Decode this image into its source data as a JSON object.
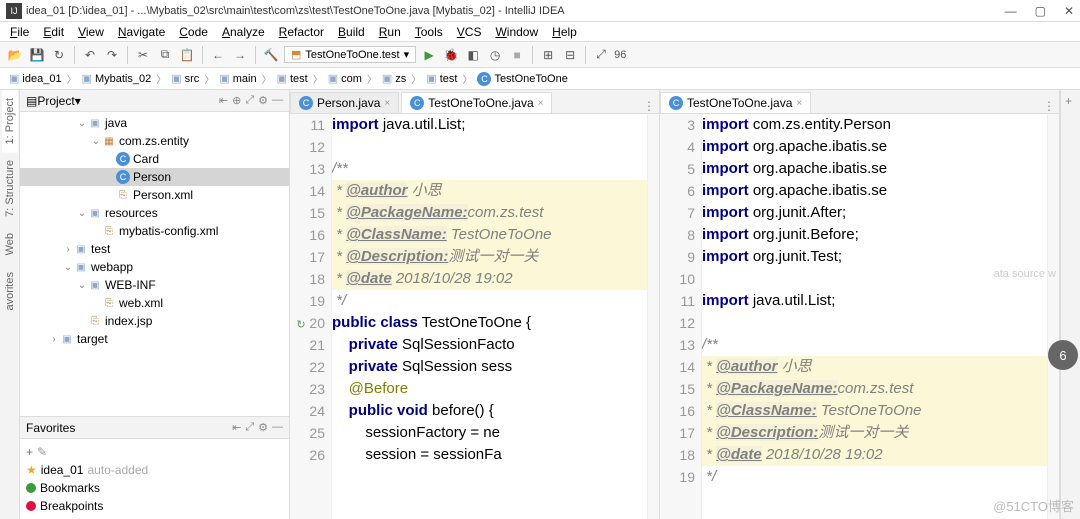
{
  "title": "idea_01 [D:\\idea_01] - ...\\Mybatis_02\\src\\main\\test\\com\\zs\\test\\TestOneToOne.java [Mybatis_02] - IntelliJ IDEA",
  "menu": [
    "File",
    "Edit",
    "View",
    "Navigate",
    "Code",
    "Analyze",
    "Refactor",
    "Build",
    "Run",
    "Tools",
    "VCS",
    "Window",
    "Help"
  ],
  "run_config": "TestOneToOne.test",
  "toolbar_num": "96",
  "breadcrumb": [
    "idea_01",
    "Mybatis_02",
    "src",
    "main",
    "test",
    "com",
    "zs",
    "test",
    "TestOneToOne"
  ],
  "project_panel": {
    "title": "Project"
  },
  "tree": [
    {
      "d": 4,
      "exp": "v",
      "icon": "folder",
      "label": "java"
    },
    {
      "d": 5,
      "exp": "v",
      "icon": "pkg",
      "label": "com.zs.entity"
    },
    {
      "d": 6,
      "exp": "",
      "icon": "class",
      "label": "Card"
    },
    {
      "d": 6,
      "exp": "",
      "icon": "class",
      "label": "Person",
      "sel": true
    },
    {
      "d": 6,
      "exp": "",
      "icon": "xml",
      "label": "Person.xml"
    },
    {
      "d": 4,
      "exp": "v",
      "icon": "folder",
      "label": "resources"
    },
    {
      "d": 5,
      "exp": "",
      "icon": "xml",
      "label": "mybatis-config.xml"
    },
    {
      "d": 3,
      "exp": ">",
      "icon": "folder",
      "label": "test"
    },
    {
      "d": 3,
      "exp": "v",
      "icon": "folder",
      "label": "webapp"
    },
    {
      "d": 4,
      "exp": "v",
      "icon": "folder",
      "label": "WEB-INF"
    },
    {
      "d": 5,
      "exp": "",
      "icon": "xml",
      "label": "web.xml"
    },
    {
      "d": 4,
      "exp": "",
      "icon": "xml",
      "label": "index.jsp"
    },
    {
      "d": 2,
      "exp": ">",
      "icon": "folder",
      "label": "target"
    }
  ],
  "favorites": {
    "title": "Favorites",
    "items": [
      {
        "icon": "star",
        "label": "idea_01",
        "note": "auto-added"
      },
      {
        "icon": "green",
        "label": "Bookmarks"
      },
      {
        "icon": "red",
        "label": "Breakpoints"
      }
    ]
  },
  "editor1": {
    "tabs": [
      {
        "label": "Person.java"
      },
      {
        "label": "TestOneToOne.java",
        "active": true
      }
    ],
    "start": 11,
    "lines": [
      {
        "t": "kw",
        "s": "import java.util.List;"
      },
      {
        "t": "",
        "s": ""
      },
      {
        "t": "doc",
        "s": "/**"
      },
      {
        "t": "tag",
        "s": " * @author 小思"
      },
      {
        "t": "tag",
        "s": " * @PackageName:com.zs.test"
      },
      {
        "t": "tag",
        "s": " * @ClassName: TestOneToOne"
      },
      {
        "t": "tag",
        "s": " * @Description:测试一对一关"
      },
      {
        "t": "tag",
        "s": " * @date 2018/10/28 19:02"
      },
      {
        "t": "doc",
        "s": " */"
      },
      {
        "t": "kw",
        "s": "public class TestOneToOne {",
        "gicon": true
      },
      {
        "t": "kw2",
        "s": "    private SqlSessionFacto"
      },
      {
        "t": "kw2",
        "s": "    private SqlSession sess"
      },
      {
        "t": "ann",
        "s": "    @Before"
      },
      {
        "t": "kw3",
        "s": "    public void before() {"
      },
      {
        "t": "pl",
        "s": "        sessionFactory = ne"
      },
      {
        "t": "pl",
        "s": "        session = sessionFa"
      }
    ]
  },
  "editor2": {
    "tabs": [
      {
        "label": "TestOneToOne.java",
        "active": true
      }
    ],
    "start": 3,
    "lines": [
      {
        "t": "kw",
        "s": "import com.zs.entity.Person"
      },
      {
        "t": "kw",
        "s": "import org.apache.ibatis.se"
      },
      {
        "t": "kw",
        "s": "import org.apache.ibatis.se"
      },
      {
        "t": "kw",
        "s": "import org.apache.ibatis.se"
      },
      {
        "t": "kw",
        "s": "import org.junit.After;"
      },
      {
        "t": "kw",
        "s": "import org.junit.Before;"
      },
      {
        "t": "kw",
        "s": "import org.junit.Test;"
      },
      {
        "t": "",
        "s": ""
      },
      {
        "t": "kw",
        "s": "import java.util.List;"
      },
      {
        "t": "",
        "s": ""
      },
      {
        "t": "doc",
        "s": "/**"
      },
      {
        "t": "tag",
        "s": " * @author 小思"
      },
      {
        "t": "tag",
        "s": " * @PackageName:com.zs.test"
      },
      {
        "t": "tag",
        "s": " * @ClassName: TestOneToOne"
      },
      {
        "t": "tag",
        "s": " * @Description:测试一对一关"
      },
      {
        "t": "tag",
        "s": " * @date 2018/10/28 19:02"
      },
      {
        "t": "doc",
        "s": " */"
      }
    ]
  },
  "ghost": "ata source w",
  "badge": "6",
  "watermark": "@51CTO博客"
}
